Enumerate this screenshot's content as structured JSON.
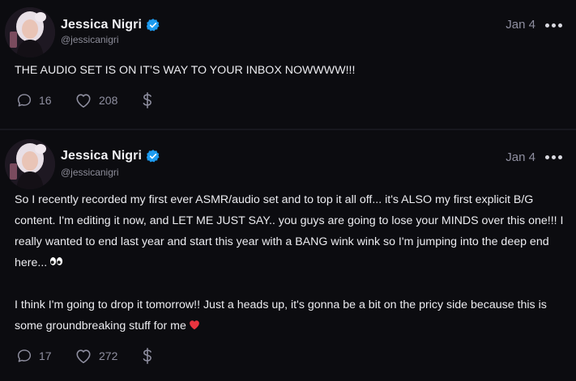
{
  "colors": {
    "background": "#0c0c10",
    "verified": "#1d9bf0",
    "muted": "#8f8fa0",
    "heart": "#e8343f"
  },
  "posts": [
    {
      "author": {
        "name": "Jessica Nigri",
        "handle": "@jessicanigri",
        "verified_icon": "verified-badge-icon"
      },
      "date": "Jan 4",
      "text": "THE AUDIO SET IS ON IT’S WAY TO YOUR INBOX NOWWWW!!!",
      "comments": "16",
      "likes": "208",
      "tip_icon": "dollar-icon"
    },
    {
      "author": {
        "name": "Jessica Nigri",
        "handle": "@jessicanigri",
        "verified_icon": "verified-badge-icon"
      },
      "date": "Jan 4",
      "text_paragraph_1": "So I recently recorded my first ever ASMR/audio set and to top it all off... it's ALSO my first explicit B/G content. I'm editing it now, and LET ME JUST SAY.. you guys are going to lose your MINDS over this one!!! I really wanted to end last year and start this year with a BANG wink wink so I'm jumping into the deep end here...",
      "text_paragraph_1_emoji": "eyes-emoji",
      "text_paragraph_2": "I think I'm going to drop it tomorrow!! Just a heads up, it's gonna be a bit on the pricy side because this is some groundbreaking stuff for me",
      "text_paragraph_2_emoji": "red-heart-emoji",
      "comments": "17",
      "likes": "272",
      "tip_icon": "dollar-icon"
    }
  ]
}
